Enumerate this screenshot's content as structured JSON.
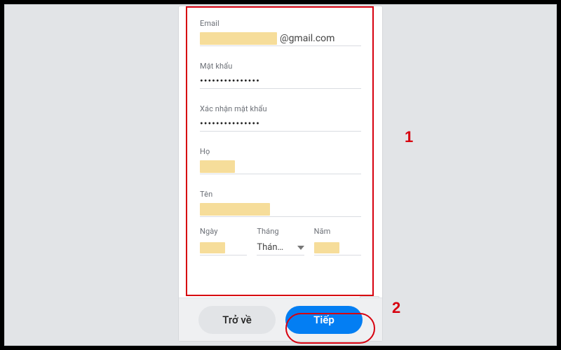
{
  "annotations": {
    "num1": "1",
    "num2": "2"
  },
  "form": {
    "email": {
      "label": "Email",
      "suffix": "@gmail.com"
    },
    "password": {
      "label": "Mật khẩu",
      "masked": "•••••••••••••••"
    },
    "confirm": {
      "label": "Xác nhận mật khẩu",
      "masked": "•••••••••••••••"
    },
    "lastname": {
      "label": "Họ"
    },
    "firstname": {
      "label": "Tên"
    },
    "dob": {
      "day": {
        "label": "Ngày"
      },
      "month": {
        "label": "Tháng",
        "value": "Thán…"
      },
      "year": {
        "label": "Năm"
      }
    }
  },
  "buttons": {
    "back": "Trở về",
    "next": "Tiếp"
  }
}
